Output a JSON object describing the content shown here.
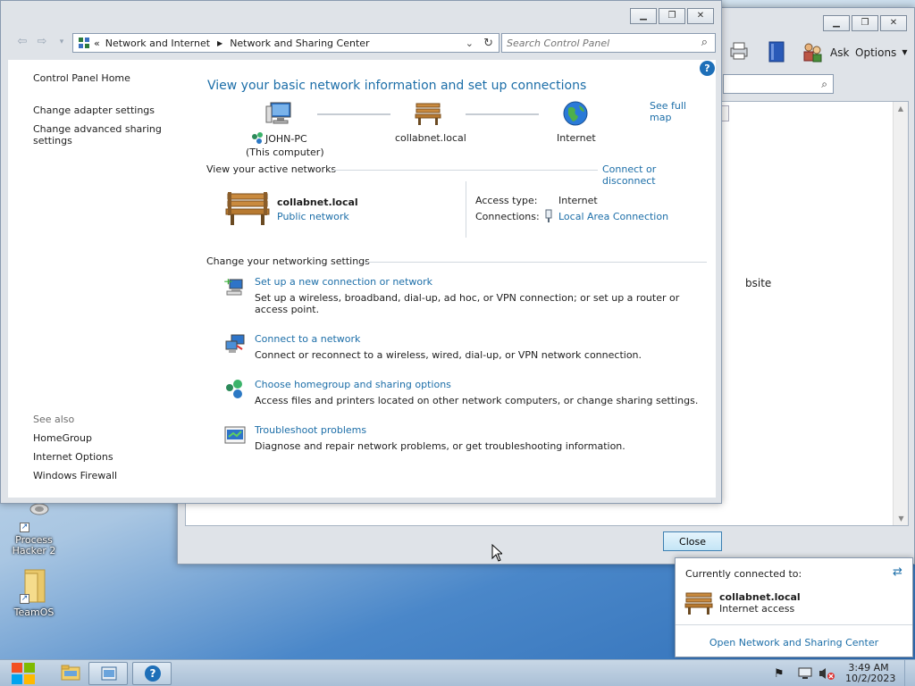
{
  "desktop": {
    "icons": [
      {
        "label": "Process Hacker 2"
      },
      {
        "label": "TeamOS"
      }
    ]
  },
  "back_window": {
    "toolbar": {
      "ask": "Ask",
      "options": "Options"
    },
    "partial_text": "bsite",
    "close_label": "Close"
  },
  "main_window": {
    "address": {
      "parts": [
        "Network and Internet",
        "Network and Sharing Center"
      ]
    },
    "search": {
      "placeholder": "Search Control Panel"
    },
    "sidebar": {
      "home": "Control Panel Home",
      "links": [
        "Change adapter settings",
        "Change advanced sharing settings"
      ],
      "see_also_title": "See also",
      "see_also": [
        "HomeGroup",
        "Internet Options",
        "Windows Firewall"
      ]
    },
    "heading": "View your basic network information and set up connections",
    "see_full_map": "See full map",
    "map": {
      "computer": "JOHN-PC",
      "computer_sub": "(This computer)",
      "network": "collabnet.local",
      "internet": "Internet"
    },
    "active_networks": {
      "title": "View your active networks",
      "action": "Connect or disconnect",
      "name": "collabnet.local",
      "category": "Public network",
      "access_type_label": "Access type:",
      "access_type_value": "Internet",
      "connections_label": "Connections:",
      "connections_value": "Local Area Connection"
    },
    "change_settings": {
      "title": "Change your networking settings",
      "tasks": [
        {
          "title": "Set up a new connection or network",
          "desc": "Set up a wireless, broadband, dial-up, ad hoc, or VPN connection; or set up a router or access point."
        },
        {
          "title": "Connect to a network",
          "desc": "Connect or reconnect to a wireless, wired, dial-up, or VPN network connection."
        },
        {
          "title": "Choose homegroup and sharing options",
          "desc": "Access files and printers located on other network computers, or change sharing settings."
        },
        {
          "title": "Troubleshoot problems",
          "desc": "Diagnose and repair network problems, or get troubleshooting information."
        }
      ]
    }
  },
  "popup": {
    "title": "Currently connected to:",
    "network": "collabnet.local",
    "status": "Internet access",
    "link": "Open Network and Sharing Center"
  },
  "taskbar": {
    "time": "3:49 AM",
    "date": "10/2/2023"
  },
  "colors": {
    "link": "#1c6ea8",
    "heading": "#1c6ea8"
  }
}
